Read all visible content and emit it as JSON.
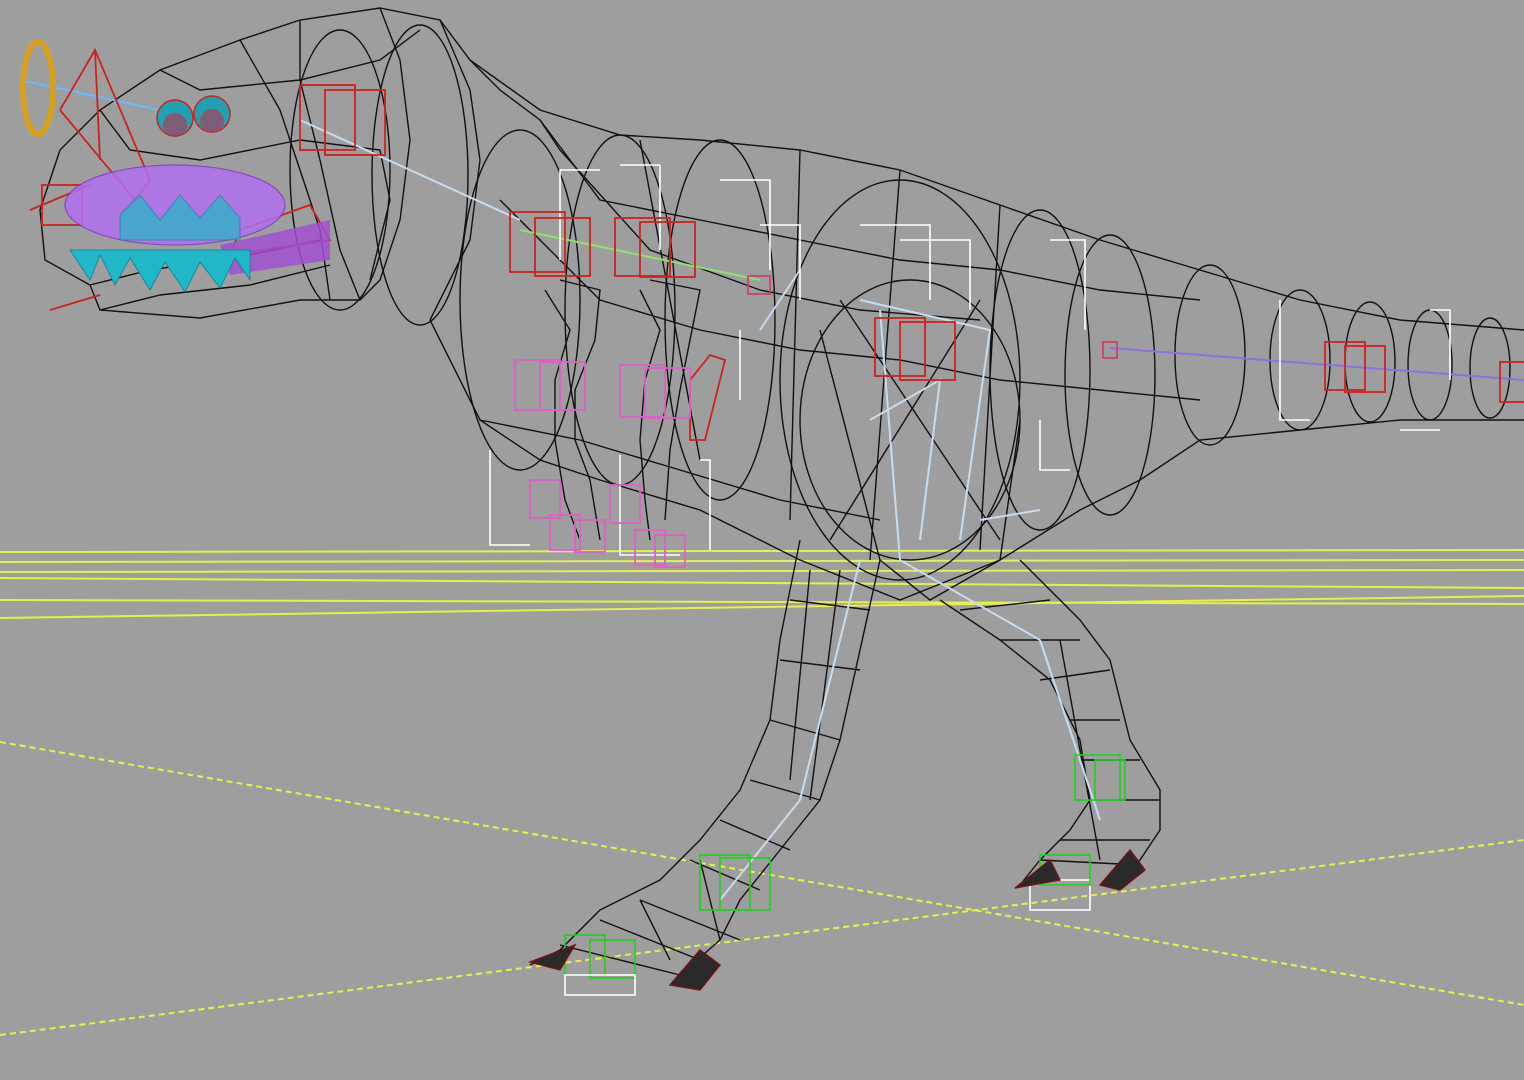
{
  "viewport": {
    "background": "#9e9e9e",
    "shading_mode": "wireframe"
  },
  "scene_objects": [
    {
      "id": "grid-lines",
      "kind": "ground-grid",
      "color": "#e6f04a"
    },
    {
      "id": "body-mesh",
      "kind": "wireframe-mesh",
      "color": "#000000"
    },
    {
      "id": "bones",
      "kind": "bone-chain",
      "color": "#c8dcf0"
    },
    {
      "id": "spine-controls",
      "kind": "control-boxes",
      "color": "#cc2222"
    },
    {
      "id": "arm-controls",
      "kind": "control-boxes",
      "color": "#e060c8"
    },
    {
      "id": "foot-controls",
      "kind": "control-boxes",
      "color": "#20d020"
    },
    {
      "id": "helper-brackets",
      "kind": "helper-objects",
      "color": "#ffffff"
    },
    {
      "id": "tongue",
      "kind": "mesh",
      "color": "#b070f0"
    },
    {
      "id": "teeth",
      "kind": "mesh",
      "color": "#20b8c8"
    },
    {
      "id": "eyes",
      "kind": "mesh",
      "color": "#20a0b0"
    },
    {
      "id": "head-ring",
      "kind": "control-ring",
      "color": "#d4a020"
    }
  ]
}
